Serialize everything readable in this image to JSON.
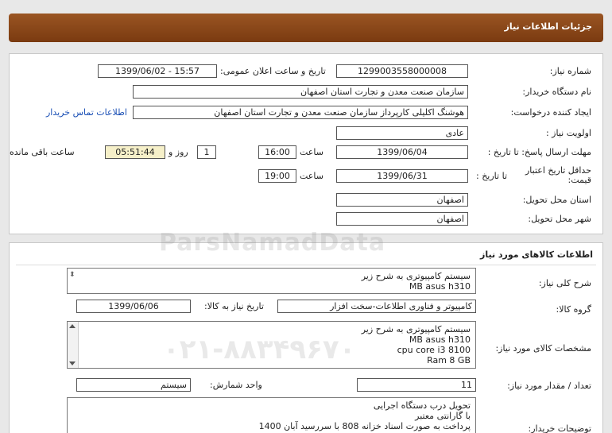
{
  "header": {
    "title": "جزئیات اطلاعات نیاز"
  },
  "need_info": {
    "need_number_label": "شماره نیاز:",
    "need_number": "1299003558000008",
    "announce_label": "تاریخ و ساعت اعلان عمومی:",
    "announce_value": "1399/06/02 - 15:57",
    "buyer_org_label": "نام دستگاه خریدار:",
    "buyer_org": "سازمان صنعت معدن و تجارت استان اصفهان",
    "requester_label": "ایجاد کننده درخواست:",
    "requester": "هوشنگ  اکلیلی کارپرداز سازمان صنعت معدن و تجارت استان اصفهان",
    "contact_link": "اطلاعات تماس خریدار",
    "priority_label": "اولویت نیاز :",
    "priority": "عادی",
    "deadline_label": "مهلت ارسال پاسخ:  تا تاریخ :",
    "deadline_date": "1399/06/04",
    "time_label": "ساعت",
    "deadline_time": "16:00",
    "days_value": "1",
    "days_label": "روز و",
    "remaining_time": "05:51:44",
    "remaining_label": "ساعت باقی مانده",
    "validity_label": "حداقل تاریخ اعتبار قیمت:",
    "validity_to_label": "تا تاریخ :",
    "validity_date": "1399/06/31",
    "validity_time_label": "ساعت",
    "validity_time": "19:00",
    "province_label": "استان محل تحویل:",
    "province": "اصفهان",
    "city_label": "شهر محل تحویل:",
    "city": "اصفهان"
  },
  "goods": {
    "section_title": "اطلاعات کالاهای مورد نیاز",
    "general_desc_label": "شرح کلی نیاز:",
    "general_desc_lines": [
      "سیستم کامپیوتری به شرح زیر",
      "MB asus h310"
    ],
    "group_label": "گروه کالا:",
    "group": "کامپیوتر و فناوری اطلاعات-سخت افزار",
    "need_date_label": "تاریخ نیاز به کالا:",
    "need_date": "1399/06/06",
    "spec_label": "مشخصات کالای مورد نیاز:",
    "spec_lines": [
      "سیستم کامپیوتری به شرح زیر",
      "MB asus h310",
      "cpu core i3 8100",
      "Ram 8 GB"
    ],
    "qty_label": "تعداد / مقدار مورد نیاز:",
    "qty": "11",
    "unit_label": "واحد شمارش:",
    "unit": "سیستم",
    "buyer_notes_label": "توضیحات خریدار:",
    "buyer_notes_lines": [
      "تحویل درب دستگاه اجرایی",
      "با گارانتی معتبر",
      "پرداخت به صورت اسناد خزانه 808 با سررسید آبان 1400"
    ]
  },
  "watermark": {
    "text1": "ParsNamadData",
    "text2": "۰۲۱-۸۸۳۴۹۶۷۰"
  }
}
